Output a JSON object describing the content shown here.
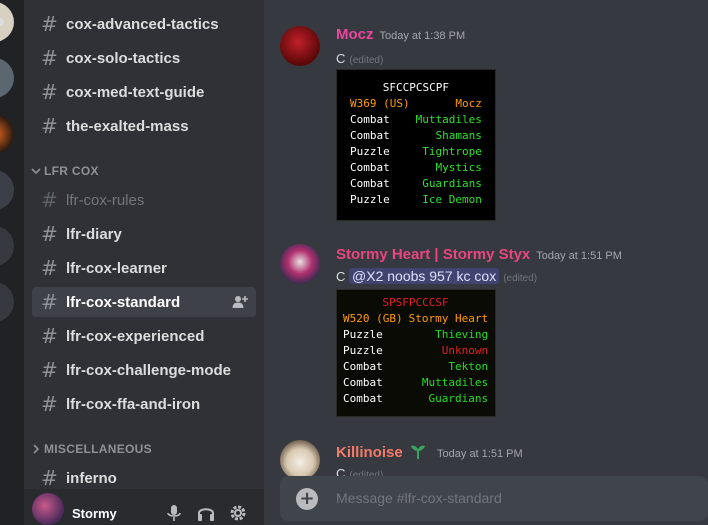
{
  "colors": {
    "bg_main": "#36393f",
    "bg_channels": "#2f3136",
    "bg_guilds": "#202225",
    "channel_text": "#dcddde",
    "channel_muted": "#72767d",
    "mocz_name": "#eb459e",
    "stormy_name": "#e9467f",
    "killinoise_name": "#f47b67"
  },
  "channels": {
    "top_group": [
      {
        "label": "cox-advanced-tactics"
      },
      {
        "label": "cox-solo-tactics"
      },
      {
        "label": "cox-med-text-guide"
      },
      {
        "label": "the-exalted-mass"
      }
    ],
    "lfr_category": "LFR COX",
    "lfr_group": [
      {
        "label": "lfr-cox-rules",
        "muted": true
      },
      {
        "label": "lfr-diary"
      },
      {
        "label": "lfr-cox-learner"
      },
      {
        "label": "lfr-cox-standard",
        "active": true
      },
      {
        "label": "lfr-cox-experienced"
      },
      {
        "label": "lfr-cox-challenge-mode"
      },
      {
        "label": "lfr-cox-ffa-and-iron"
      }
    ],
    "misc_category": "MISCELLANEOUS",
    "misc_group": [
      {
        "label": "inferno"
      }
    ]
  },
  "user": {
    "name": "Stormy"
  },
  "messages": [
    {
      "author": "Mocz",
      "timestamp": "Today at 1:38 PM",
      "text": "C",
      "edited": "(edited)",
      "screenshot": {
        "header": "SFCCPCSCPF",
        "world": "W369 (US)",
        "world_user": "Mocz",
        "rows": [
          {
            "type": "Combat",
            "room": "Muttadiles"
          },
          {
            "type": "Combat",
            "room": "Shamans"
          },
          {
            "type": "Puzzle",
            "room": "Tightrope"
          },
          {
            "type": "Combat",
            "room": "Mystics"
          },
          {
            "type": "Combat",
            "room": "Guardians"
          },
          {
            "type": "Puzzle",
            "room": "Ice Demon"
          }
        ]
      }
    },
    {
      "author": "Stormy Heart | Stormy Styx",
      "timestamp": "Today at 1:51 PM",
      "text": "C",
      "mention": "@X2 noobs 957 kc cox",
      "edited": "(edited)",
      "screenshot": {
        "header": "SPSFPCCCSF",
        "world": "W520 (GB)",
        "world_user": "Stormy Heart",
        "rows": [
          {
            "type": "Puzzle",
            "room": "Thieving",
            "color": "#22dd22"
          },
          {
            "type": "Puzzle",
            "room": "Unknown",
            "color": "#e02020"
          },
          {
            "type": "Combat",
            "room": "Tekton",
            "color": "#22dd22"
          },
          {
            "type": "Combat",
            "room": "Muttadiles",
            "color": "#22dd22"
          },
          {
            "type": "Combat",
            "room": "Guardians",
            "color": "#22dd22"
          }
        ]
      }
    },
    {
      "author": "Killinoise",
      "timestamp": "Today at 1:51 PM",
      "text": "C",
      "edited": "(edited)"
    }
  ],
  "composer": {
    "placeholder": "Message #lfr-cox-standard"
  }
}
